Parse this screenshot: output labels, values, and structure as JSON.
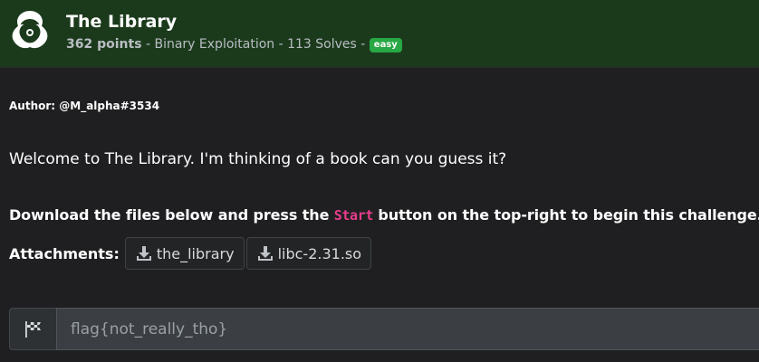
{
  "challenge": {
    "title": "The Library",
    "points": "362 points",
    "meta_rest": " - Binary Exploitation - 113 Solves - ",
    "difficulty": "easy"
  },
  "description": {
    "author": "Author: @M_alpha#3534",
    "welcome": "Welcome to The Library. I'm thinking of a book can you guess it?",
    "instruction_prefix": "Download the files below and press the ",
    "instruction_code": "Start",
    "instruction_suffix": " button on the top-right to begin this challenge."
  },
  "attachments": {
    "label": "Attachments:",
    "files": [
      {
        "name": "the_library",
        "icon": "download-icon"
      },
      {
        "name": "libc-2.31.so",
        "icon": "download-icon"
      }
    ]
  },
  "flag": {
    "icon": "checkered-flag-icon",
    "placeholder": "flag{not_really_tho}"
  },
  "colors": {
    "header_bg": "#1b3a1c",
    "page_bg": "#1f1f21",
    "badge": "#28a745",
    "code": "#e83e8c"
  }
}
